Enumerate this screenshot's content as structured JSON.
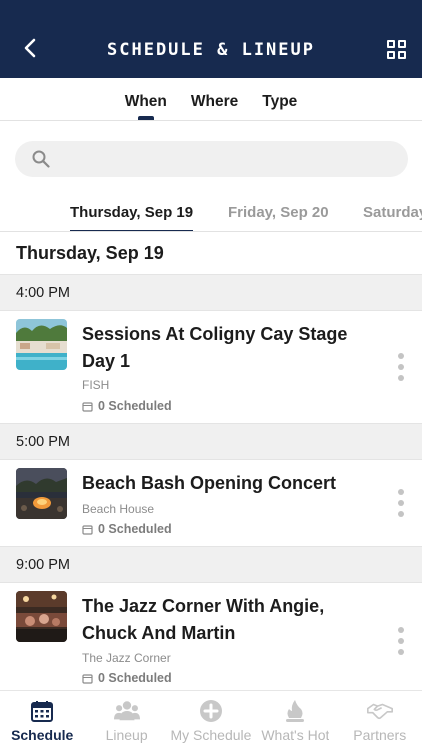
{
  "header": {
    "title": "SCHEDULE & LINEUP"
  },
  "filter_tabs": [
    {
      "label": "When",
      "active": true
    },
    {
      "label": "Where",
      "active": false
    },
    {
      "label": "Type",
      "active": false
    }
  ],
  "search": {
    "placeholder": "",
    "value": ""
  },
  "day_tabs": [
    {
      "label": "Thursday, Sep 19",
      "active": true
    },
    {
      "label": "Friday, Sep 20",
      "active": false
    },
    {
      "label": "Saturday",
      "active": false
    }
  ],
  "date_heading": "Thursday, Sep 19",
  "slots": [
    {
      "time": "4:00 PM",
      "event": {
        "title": "Sessions At Coligny Cay Stage Day 1",
        "venue": "FISH",
        "scheduled": "0 Scheduled"
      }
    },
    {
      "time": "5:00 PM",
      "event": {
        "title": "Beach Bash Opening Concert",
        "venue": "Beach House",
        "scheduled": "0 Scheduled"
      }
    },
    {
      "time": "9:00 PM",
      "event": {
        "title": "The Jazz Corner With Angie, Chuck And Martin",
        "venue": "The Jazz Corner",
        "scheduled": "0 Scheduled"
      }
    }
  ],
  "bottom_nav": [
    {
      "label": "Schedule",
      "icon": "calendar-icon",
      "active": true
    },
    {
      "label": "Lineup",
      "icon": "people-icon",
      "active": false
    },
    {
      "label": "My Schedule",
      "icon": "plus-circle-icon",
      "active": false
    },
    {
      "label": "What's Hot",
      "icon": "flame-icon",
      "active": false
    },
    {
      "label": "Partners",
      "icon": "handshake-icon",
      "active": false
    }
  ],
  "colors": {
    "primary": "#172a4f",
    "muted": "#9a9a9a",
    "section_bg": "#f0f0f0"
  }
}
